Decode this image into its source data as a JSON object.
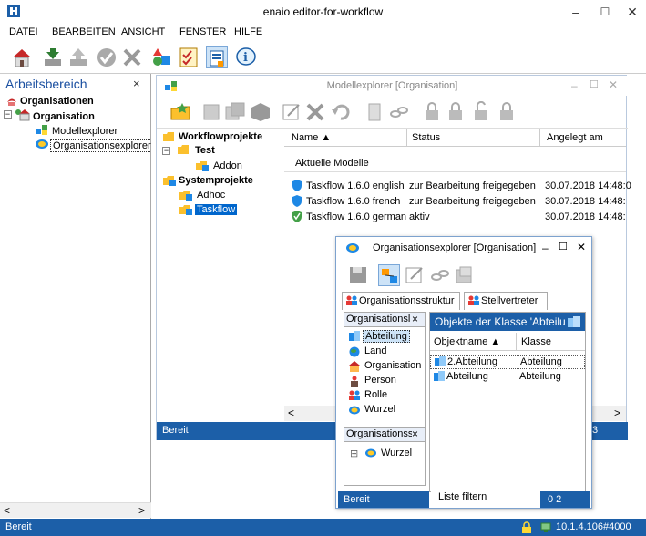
{
  "app": {
    "title": "enaio editor-for-workflow",
    "minimize": "–",
    "maximize": "☐",
    "close": "✕"
  },
  "menu": [
    "DATEI",
    "BEARBEITEN",
    "ANSICHT",
    "FENSTER",
    "HILFE"
  ],
  "left_panel": {
    "title": "Arbeitsbereich",
    "close": "×",
    "tree": {
      "root": "Organisationen",
      "org": "Organisation",
      "child1": "Modellexplorer",
      "child2": "Organisationsexplorer"
    },
    "scroll_left": "<",
    "scroll_right": ">"
  },
  "status": {
    "left": "Bereit",
    "right": "10.1.4.106#4000"
  },
  "model_explorer": {
    "title": "Modellexplorer [Organisation]",
    "win_min": "–",
    "win_max": "☐",
    "win_close": "✕",
    "tree": {
      "workflow_projects": "Workflowprojekte",
      "test": "Test",
      "addon": "Addon",
      "system_projects": "Systemprojekte",
      "adhoc": "Adhoc",
      "taskflow": "Taskflow"
    },
    "columns": {
      "name": "Name ▲",
      "status": "Status",
      "created": "Angelegt am"
    },
    "section": "Aktuelle Modelle",
    "rows": [
      {
        "name": "Taskflow 1.6.0 english",
        "status": "zur Bearbeitung freigegeben",
        "date": "30.07.2018 14:48:0"
      },
      {
        "name": "Taskflow 1.6.0 french",
        "status": "zur Bearbeitung freigegeben",
        "date": "30.07.2018 14:48:"
      },
      {
        "name": "Taskflow 1.6.0 german",
        "status": "aktiv",
        "date": "30.07.2018 14:48:"
      }
    ],
    "status": "Bereit",
    "status_right": "3",
    "scroll_left": "<",
    "scroll_right": ">"
  },
  "org_explorer": {
    "title": "Organisationsexplorer [Organisation]",
    "win_min": "–",
    "win_max": "☐",
    "win_close": "✕",
    "tabs": [
      "Organisationsstruktur",
      "Stellvertreter"
    ],
    "class_panel": {
      "header": "Organisationsl",
      "close": "×",
      "items": [
        "Abteilung",
        "Land",
        "Organisation",
        "Person",
        "Rolle",
        "Wurzel"
      ]
    },
    "org_panel": {
      "header": "Organisationss",
      "close": "×",
      "expander": "⊞",
      "item": "Wurzel"
    },
    "objects": {
      "header": "Objekte der Klasse 'Abteilu",
      "col_name": "Objektname ▲",
      "col_class": "Klasse",
      "rows": [
        {
          "name": "2.Abteilung",
          "class": "Abteilung"
        },
        {
          "name": "Abteilung",
          "class": "Abteilung"
        }
      ]
    },
    "status": "Bereit",
    "filter": "Liste filtern",
    "count": "0  2"
  },
  "colors": {
    "accent": "#1c5fa8",
    "selection": "#0066cc"
  }
}
